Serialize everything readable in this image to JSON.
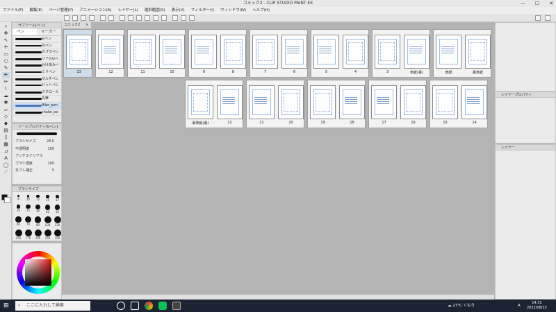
{
  "window": {
    "title": "コミック2 - CLIP STUDIO PAINT EX",
    "controls": [
      "—",
      "☐",
      "✕"
    ]
  },
  "menu": [
    "ファイル(F)",
    "編集(E)",
    "ページ管理(P)",
    "アニメーション(A)",
    "レイヤー(L)",
    "選択範囲(S)",
    "表示(V)",
    "フィルター(I)",
    "ウィンドウ(W)",
    "ヘルプ(H)"
  ],
  "subtool_panel": {
    "title": "サブツール[ペン]",
    "tabs": [
      "ペン",
      "マーカー"
    ],
    "brushes": [
      "Gペン",
      "丸ペン",
      "カブラペン",
      "リアルGペン",
      "かけあみペン",
      "ミリペン",
      "マルチペン",
      "ドットペン",
      "スクロール",
      "丸筆",
      "filler_pen",
      "shake_pen"
    ]
  },
  "tool_property": {
    "title": "ツールプロパティ[Gペン]",
    "brush_size_label": "ブラシサイズ",
    "brush_size": "28.0",
    "opacity_label": "不透明度",
    "opacity": "100",
    "antialias_label": "アンチエイリアス",
    "density_label": "ブラシ濃度",
    "density": "100",
    "stabilize_label": "手ブレ補正",
    "stabilize": "5"
  },
  "brush_size_panel": {
    "title": "ブラシサイズ",
    "sizes": [
      "8",
      "10",
      "12",
      "15",
      "17",
      "20",
      "25",
      "30",
      "40",
      "50",
      "60",
      "70",
      "80",
      "100",
      "120",
      "150",
      "170",
      "200",
      "250",
      "300"
    ]
  },
  "doc_tab": "コミック2",
  "spreads_row1": [
    {
      "pages": [
        "13"
      ],
      "selected": true
    },
    {
      "pages": [
        "12"
      ]
    },
    {
      "pages": [
        "11",
        "10"
      ]
    },
    {
      "pages": [
        "9",
        "8"
      ]
    },
    {
      "pages": [
        "7",
        "6"
      ]
    },
    {
      "pages": [
        "5",
        "4"
      ]
    },
    {
      "pages": [
        "3",
        "表紙(裏)"
      ]
    },
    {
      "pages": [
        "表紙",
        "裏表紙"
      ]
    }
  ],
  "spreads_row2": [
    {
      "pages": [
        "裏表紙(裏)",
        "22"
      ]
    },
    {
      "pages": [
        "21",
        "20"
      ]
    },
    {
      "pages": [
        "19",
        "18"
      ]
    },
    {
      "pages": [
        "17",
        "16"
      ]
    },
    {
      "pages": [
        "15",
        "14"
      ]
    }
  ],
  "right_panels": {
    "layer_property": "レイヤープロパティ",
    "layer": "レイヤー"
  },
  "taskbar": {
    "search_placeholder": "ここに入力して検索",
    "weather": "27°C くもり",
    "ime": "A",
    "time": "14:31",
    "date": "2022/08/15"
  }
}
